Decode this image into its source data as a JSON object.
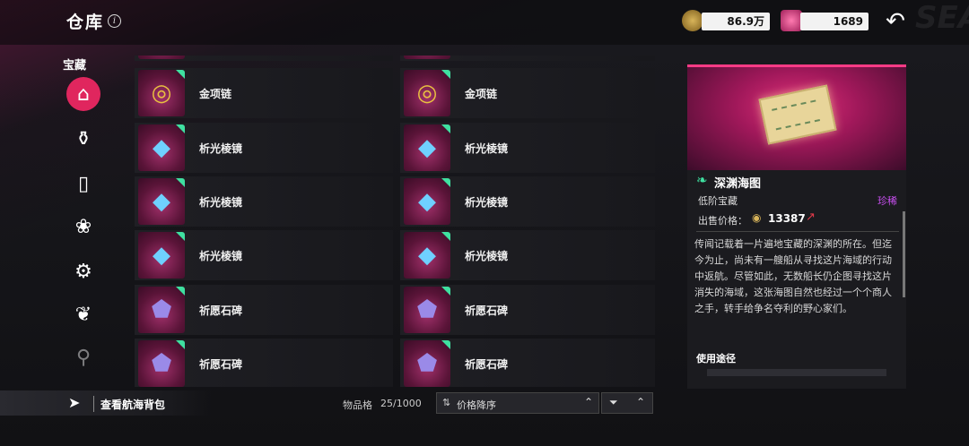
{
  "header": {
    "title": "仓库",
    "info_icon": "i",
    "currency_gold": "86.9万",
    "currency_gem": "1689",
    "back_icon": "back-arrow-icon"
  },
  "sidebar": {
    "title": "宝藏",
    "categories": [
      {
        "icon": "treasure-chest-icon",
        "glyph": "⌂"
      },
      {
        "icon": "bottle-icon",
        "glyph": "⚱"
      },
      {
        "icon": "scroll-icon",
        "glyph": "▯"
      },
      {
        "icon": "flower-icon",
        "glyph": "❀"
      },
      {
        "icon": "gear-icon",
        "glyph": "⚙"
      },
      {
        "icon": "herb-icon",
        "glyph": "❦"
      },
      {
        "icon": "shovel-icon",
        "glyph": "⚲"
      }
    ]
  },
  "items": [
    {
      "label": "金项链",
      "glyph": "◎"
    },
    {
      "label": "金项链",
      "glyph": "◎"
    },
    {
      "label": "析光棱镜",
      "glyph": "◆"
    },
    {
      "label": "析光棱镜",
      "glyph": "◆"
    },
    {
      "label": "析光棱镜",
      "glyph": "◆"
    },
    {
      "label": "析光棱镜",
      "glyph": "◆"
    },
    {
      "label": "析光棱镜",
      "glyph": "◆"
    },
    {
      "label": "析光棱镜",
      "glyph": "◆"
    },
    {
      "label": "祈愿石碑",
      "glyph": "⬟"
    },
    {
      "label": "祈愿石碑",
      "glyph": "⬟"
    },
    {
      "label": "祈愿石碑",
      "glyph": "⬟"
    },
    {
      "label": "祈愿石碑",
      "glyph": "⬟"
    }
  ],
  "detail": {
    "name": "深渊海图",
    "type": "低阶宝藏",
    "rarity": "珍稀",
    "price_label": "出售价格：",
    "price_value": "13387",
    "description": "传闻记载着一片遍地宝藏的深渊的所在。但迄今为止，尚未有一艘船从寻找这片海域的行动中返航。尽管如此，无数船长仍企图寻找这片消失的海域，这张海图自然也经过一个个商人之手，转手给争名夺利的野心家们。",
    "usage_title": "使用途径"
  },
  "footer": {
    "bag_label": "查看航海背包",
    "slots_label": "物品格",
    "slots_value": "25/1000",
    "sort_label": "价格降序"
  },
  "colors": {
    "accent": "#e0265e",
    "rarity": "#c84ff0",
    "new_badge": "#3fe0a0"
  }
}
